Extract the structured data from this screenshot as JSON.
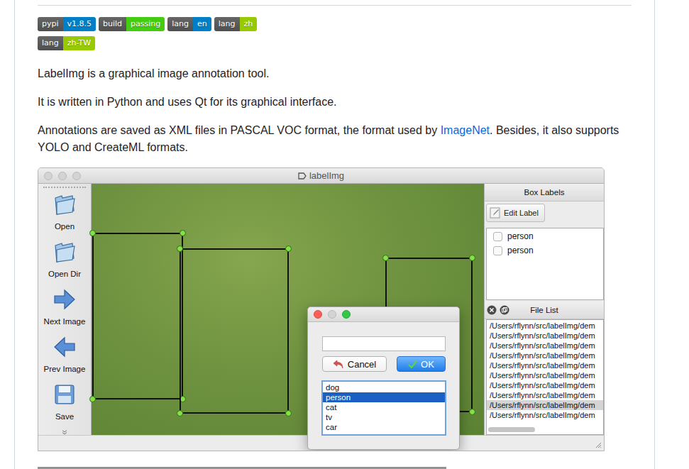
{
  "badges": [
    [
      {
        "label": "pypi",
        "value": "v1.8.5",
        "color": "#007ec6"
      },
      {
        "label": "build",
        "value": "passing",
        "color": "#44cc11"
      },
      {
        "label": "lang",
        "value": "en",
        "color": "#007ec6"
      },
      {
        "label": "lang",
        "value": "zh",
        "color": "#97ca00"
      }
    ],
    [
      {
        "label": "lang",
        "value": "zh-TW",
        "color": "#97ca00"
      }
    ]
  ],
  "paragraphs": [
    [
      {
        "text": "LabelImg is a graphical image annotation tool.",
        "link": false
      }
    ],
    [
      {
        "text": "It is written in Python and uses Qt for its graphical interface.",
        "link": false
      }
    ],
    [
      {
        "text": "Annotations are saved as XML files in PASCAL VOC format, the format used by ",
        "link": false
      },
      {
        "text": "ImageNet",
        "link": true
      },
      {
        "text": ". Besides, it also supports YOLO and CreateML formats.",
        "link": false
      }
    ]
  ],
  "screenshot": {
    "window": {
      "title": "labelImg"
    },
    "toolbar": [
      {
        "label": "Open",
        "kind": "open"
      },
      {
        "label": "Open Dir",
        "kind": "open-dir"
      },
      {
        "label": "Next Image",
        "kind": "next"
      },
      {
        "label": "Prev Image",
        "kind": "prev"
      },
      {
        "label": "Save",
        "kind": "save"
      }
    ],
    "box_labels": {
      "title": "Box Labels",
      "edit_button": "Edit Label",
      "items": [
        {
          "text": "person",
          "checked": false
        },
        {
          "text": "person",
          "checked": false
        }
      ]
    },
    "file_list": {
      "title": "File List",
      "files": [
        {
          "path": "/Users/rflynn/src/labelImg/dem",
          "selected": false
        },
        {
          "path": "/Users/rflynn/src/labelImg/dem",
          "selected": false
        },
        {
          "path": "/Users/rflynn/src/labelImg/dem",
          "selected": false
        },
        {
          "path": "/Users/rflynn/src/labelImg/dem",
          "selected": false
        },
        {
          "path": "/Users/rflynn/src/labelImg/dem",
          "selected": false
        },
        {
          "path": "/Users/rflynn/src/labelImg/dem",
          "selected": false
        },
        {
          "path": "/Users/rflynn/src/labelImg/dem",
          "selected": false
        },
        {
          "path": "/Users/rflynn/src/labelImg/dem",
          "selected": false
        },
        {
          "path": "/Users/rflynn/src/labelImg/dem",
          "selected": true
        },
        {
          "path": "/Users/rflynn/src/labelImg/dem",
          "selected": false
        }
      ]
    },
    "dialog": {
      "input": "",
      "buttons": [
        {
          "label": "Cancel",
          "default": false
        },
        {
          "label": "OK",
          "default": true
        }
      ],
      "classes": [
        {
          "text": "dog",
          "selected": false
        },
        {
          "text": "person",
          "selected": true
        },
        {
          "text": "cat",
          "selected": false
        },
        {
          "text": "tv",
          "selected": false
        },
        {
          "text": "car",
          "selected": false
        }
      ]
    }
  }
}
